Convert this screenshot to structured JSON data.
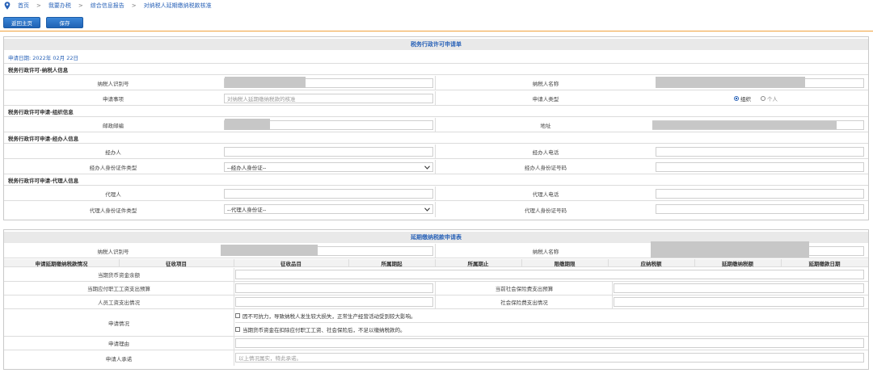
{
  "breadcrumb": {
    "items": [
      "首页",
      "我要办税",
      "综合信息报告",
      "对纳税人延期缴纳税款核准"
    ],
    "separator": ">"
  },
  "toolbar": {
    "back_label": "返回主页",
    "save_label": "保存"
  },
  "form1": {
    "title": "税务行政许可申请单",
    "apply_date": "申请日期:  2022年  02月  22日",
    "sec_taxpayer": "税务行政许可-纳税人信息",
    "taxpayer_id_label": "纳税人识别号",
    "taxpayer_name_label": "纳税人名称",
    "item_label": "申请事项",
    "item_value": "对纳税人延期缴纳税款的核准",
    "applicant_type_label": "申请人类型",
    "type_org": "组织",
    "type_person": "个人",
    "sec_org": "税务行政许可申请-组织信息",
    "postcode_label": "邮政邮编",
    "address_label": "地址",
    "sec_agent": "税务行政许可申请-经办人信息",
    "handler_label": "经办人",
    "handler_phone_label": "经办人电话",
    "handler_idtype_label": "经办人身份证件类型",
    "handler_idtype_value": "--经办人身份证--",
    "handler_idno_label": "经办人身份证号码",
    "sec_proxy": "税务行政许可申请-代理人信息",
    "proxy_label": "代理人",
    "proxy_phone_label": "代理人电话",
    "proxy_idtype_label": "代理人身份证件类型",
    "proxy_idtype_value": "--代理人身份证--",
    "proxy_idno_label": "代理人身份证号码"
  },
  "form2": {
    "title": "延期缴纳税款申请表",
    "taxpayer_id_label": "纳税人识别号",
    "taxpayer_name_label": "纳税人名称",
    "table_headers": [
      "申请延期缴纳税款情况",
      "征收项目",
      "征收品目",
      "所属期起",
      "所属期止",
      "限缴期限",
      "应纳税额",
      "延期缴纳税额",
      "延期缴款日期"
    ],
    "cash_balance_label": "当期货币资金余额",
    "payroll_label": "当期应付职工工资支出预算",
    "social_label": "当前社会保险费支出预算",
    "staff_wage_label": "人员工资支出情况",
    "social_exp_label": "社会保险费支出情况",
    "situation_label": "申请情况",
    "reason1": "因不可抗力，导致纳税人发生较大损失，正常生产经营活动受到较大影响。",
    "reason2": "当期货币资金在扣除应付职工工资、社会保险后，不足以缴纳税款的。",
    "reason_label": "申请理由",
    "promise_label": "申请人承诺",
    "promise_placeholder": "以上情况属实，特此承诺。"
  },
  "colors": {
    "accent": "#2a63b8",
    "toolbar_line": "#f0a23c",
    "title_bg": "#e9e9e9"
  }
}
